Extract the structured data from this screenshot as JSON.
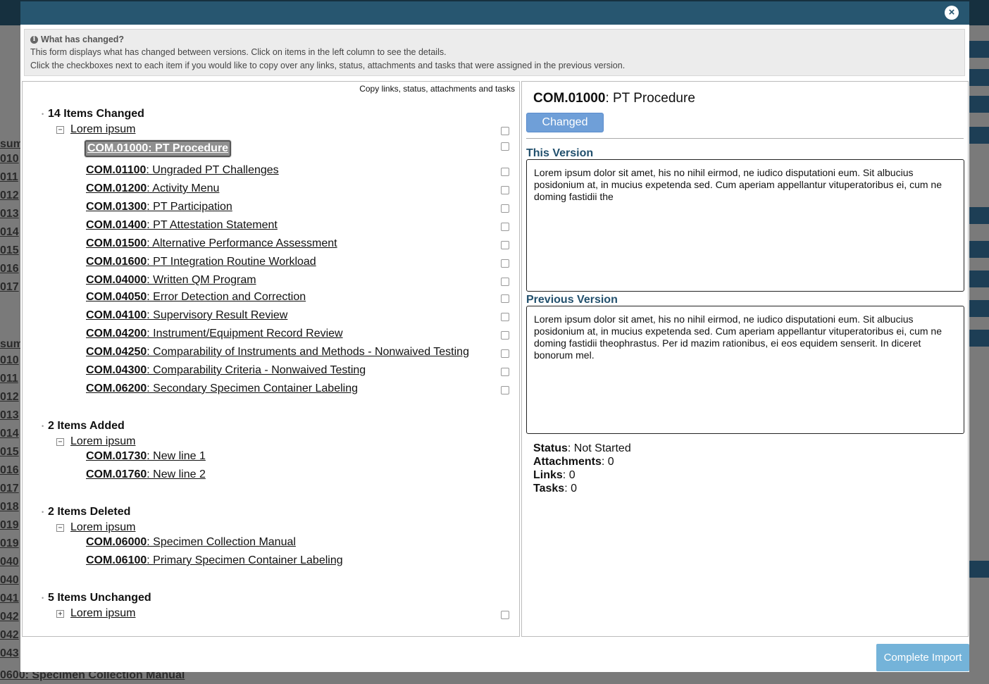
{
  "background": {
    "left_items": [
      "sum",
      "010",
      "011",
      "012",
      "013",
      "014",
      "015",
      "016",
      "017",
      "sum",
      "010",
      "011",
      "012",
      "013",
      "014",
      "015",
      "016",
      "017",
      "018",
      "019",
      "019",
      "040",
      "040",
      "041",
      "042",
      "042",
      "043"
    ],
    "bottom_item": "0600: Specimen Collection Manual"
  },
  "modal": {
    "close_icon": "×",
    "info": {
      "title": "What has changed?",
      "line1": "This form displays what has changed between versions. Click on items in the left column to see the details.",
      "line2": "Click the checkboxes next to each item if you would like to copy over any links, status, attachments and tasks that were assigned in the previous version."
    },
    "copy_header": "Copy links, status, attachments and tasks",
    "groups": {
      "changed": {
        "title": "14 Items Changed",
        "node_label": "Lorem ipsum",
        "items": [
          {
            "code": "COM.01000",
            "title": ": PT Procedure"
          },
          {
            "code": "COM.01100",
            "title": ": Ungraded PT Challenges"
          },
          {
            "code": "COM.01200",
            "title": ": Activity Menu"
          },
          {
            "code": "COM.01300",
            "title": ": PT Participation"
          },
          {
            "code": "COM.01400",
            "title": ": PT Attestation Statement"
          },
          {
            "code": "COM.01500",
            "title": ": Alternative Performance Assessment"
          },
          {
            "code": "COM.01600",
            "title": ": PT Integration Routine Workload"
          },
          {
            "code": "COM.04000",
            "title": ": Written QM Program"
          },
          {
            "code": "COM.04050",
            "title": ": Error Detection and Correction"
          },
          {
            "code": "COM.04100",
            "title": ": Supervisory Result Review"
          },
          {
            "code": "COM.04200",
            "title": ": Instrument/Equipment Record Review"
          },
          {
            "code": "COM.04250",
            "title": ": Comparability of Instruments and Methods - Nonwaived Testing"
          },
          {
            "code": "COM.04300",
            "title": ": Comparability Criteria - Nonwaived Testing"
          },
          {
            "code": "COM.06200",
            "title": ": Secondary Specimen Container Labeling"
          }
        ]
      },
      "added": {
        "title": "2 Items Added",
        "node_label": "Lorem ipsum",
        "items": [
          {
            "code": "COM.01730",
            "title": ": New line 1"
          },
          {
            "code": "COM.01760",
            "title": ": New line 2"
          }
        ]
      },
      "deleted": {
        "title": "2 Items Deleted",
        "node_label": "Lorem ipsum",
        "items": [
          {
            "code": "COM.06000",
            "title": ": Specimen Collection Manual"
          },
          {
            "code": "COM.06100",
            "title": ": Primary Specimen Container Labeling"
          }
        ]
      },
      "unchanged": {
        "title": "5 Items Unchanged",
        "node_label": "Lorem ipsum"
      }
    },
    "detail": {
      "code": "COM.01000",
      "title": ": PT Procedure",
      "status_chip": "Changed",
      "this_version_label": "This Version",
      "this_version_text": "Lorem ipsum dolor sit amet, his no nihil eirmod, ne iudico disputationi eum. Sit albucius posidonium at, in mucius expetenda sed. Cum aperiam appellantur vituperatoribus ei, cum ne doming fastidii the",
      "previous_version_label": "Previous Version",
      "previous_version_text": "Lorem ipsum dolor sit amet, his no nihil eirmod, ne iudico disputationi eum. Sit albucius posidonium at, in mucius expetenda sed. Cum aperiam appellantur vituperatoribus ei, cum ne doming fastidii theophrastus. Per id mazim rationibus, ei eos equidem senserit. In diceret bonorum mel.",
      "status_label": "Status",
      "status_value": ": Not Started",
      "attachments_label": "Attachments",
      "attachments_value": ": 0",
      "links_label": "Links",
      "links_value": ": 0",
      "tasks_label": "Tasks",
      "tasks_value": ": 0"
    },
    "complete_button": "Complete Import"
  },
  "colors": {
    "header": "#275670",
    "chip": "#6f9fd8",
    "version_label": "#22506d",
    "complete_button": "#74b3d9"
  }
}
